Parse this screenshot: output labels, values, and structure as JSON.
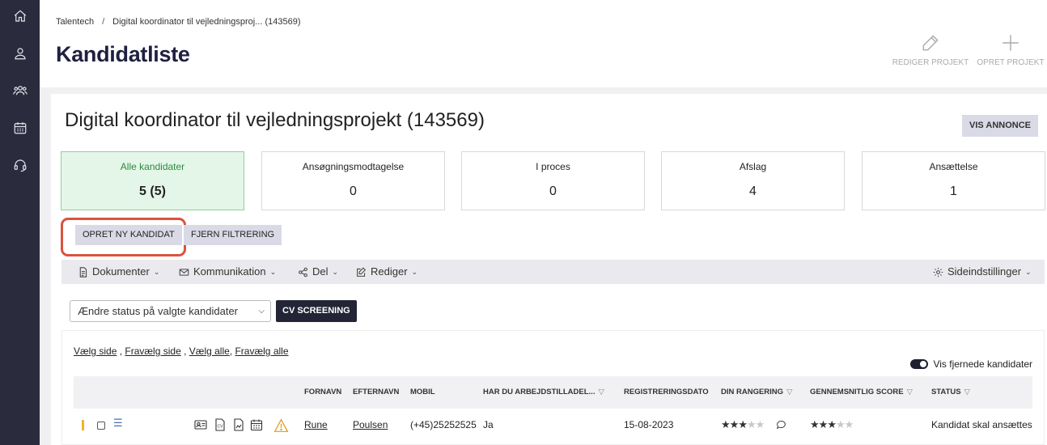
{
  "sidebar": {
    "icons": [
      "home-icon",
      "user-icon",
      "group-icon",
      "calendar-icon",
      "support-headset-icon"
    ]
  },
  "header": {
    "breadcrumb_root": "Talentech",
    "breadcrumb_sep": "/",
    "breadcrumb_current": "Digital koordinator til vejledningsproj... (143569)",
    "title": "Kandidatliste",
    "edit_project_label": "REDIGER PROJEKT",
    "create_project_label": "OPRET PROJEKT"
  },
  "project": {
    "title": "Digital koordinator til vejledningsprojekt (143569)",
    "view_ad_label": "VIS ANNONCE"
  },
  "stats": [
    {
      "label": "Alle kandidater",
      "value": "5 (5)"
    },
    {
      "label": "Ansøgningsmodtagelse",
      "value": "0"
    },
    {
      "label": "I proces",
      "value": "0"
    },
    {
      "label": "Afslag",
      "value": "4"
    },
    {
      "label": "Ansættelse",
      "value": "1"
    }
  ],
  "actions": {
    "create_candidate": "OPRET NY KANDIDAT",
    "remove_filter": "FJERN FILTRERING"
  },
  "toolbar": {
    "documents": "Dokumenter",
    "communication": "Kommunikation",
    "share": "Del",
    "edit": "Rediger",
    "page_settings": "Sideindstillinger"
  },
  "bulk": {
    "status_select": "Ændre status på valgte kandidater",
    "cv_screening": "CV SCREENING"
  },
  "selection": {
    "select_page": "Vælg side",
    "deselect_page": "Fravælg side",
    "select_all": "Vælg alle",
    "deselect_all": "Fravælg alle",
    "show_removed": "Vis fjernede kandidater"
  },
  "table": {
    "columns": {
      "firstname": "FORNAVN",
      "lastname": "EFTERNAVN",
      "mobile": "MOBIL",
      "work_permit": "HAR DU ARBEJDSTILLADEL...",
      "reg_date": "REGISTRERINGSDATO",
      "your_rating": "DIN RANGERING",
      "avg_score": "GENNEMSNITLIG SCORE",
      "status": "STATUS"
    },
    "rows": [
      {
        "firstname": "Rune",
        "lastname": "Poulsen",
        "mobile": "(+45)25252525",
        "work_permit": "Ja",
        "reg_date": "15-08-2023",
        "your_rating": 3,
        "avg_score": 3,
        "status": "Kandidat skal ansættes"
      }
    ]
  },
  "colors": {
    "sidebar_bg": "#2a2b3d",
    "active_stat_bg": "#e4f6e8",
    "active_stat_border": "#8fd19e",
    "highlight_ring": "#d9533e",
    "primary_dark": "#232536",
    "row_marker": "#f0b429"
  }
}
